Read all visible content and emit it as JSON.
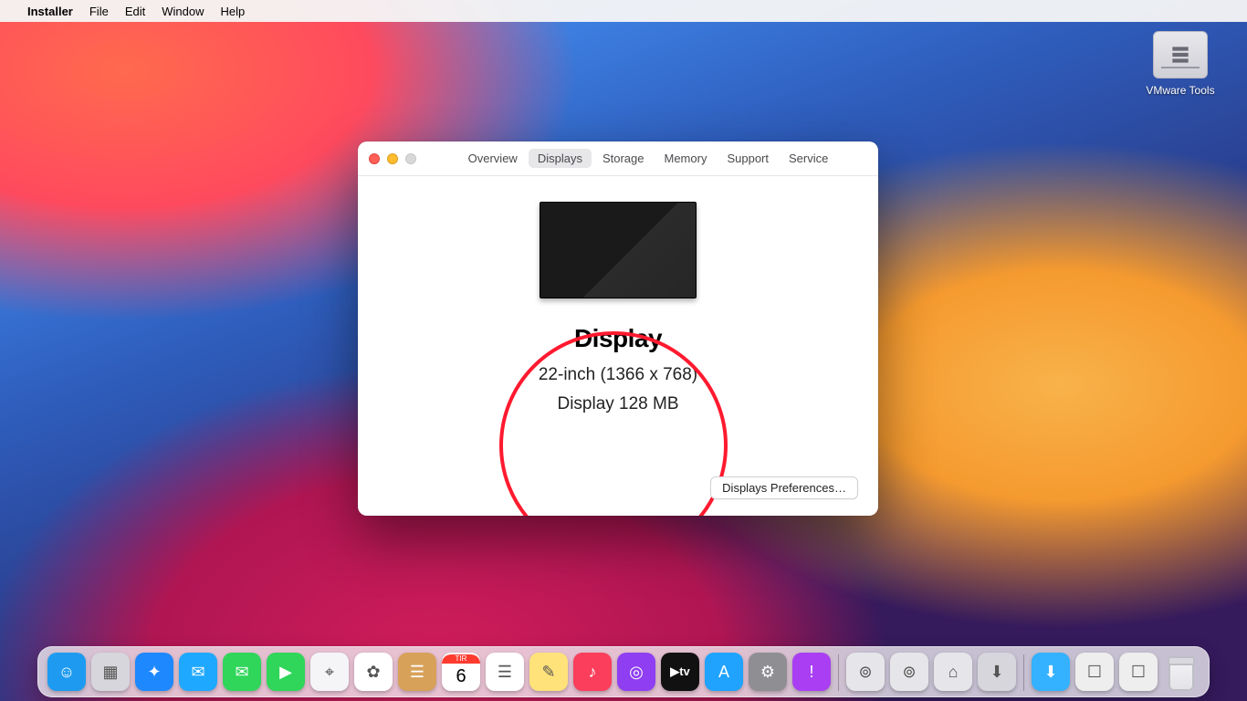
{
  "menubar": {
    "app_name": "Installer",
    "items": [
      "File",
      "Edit",
      "Window",
      "Help"
    ]
  },
  "desktop": {
    "disk_label": "VMware Tools"
  },
  "about_window": {
    "tabs": [
      "Overview",
      "Displays",
      "Storage",
      "Memory",
      "Support",
      "Service"
    ],
    "active_tab_index": 1,
    "display": {
      "title": "Display",
      "size_line": "22-inch (1366 x 768)",
      "gpu_line": "Display 128 MB"
    },
    "prefs_button": "Displays Preferences…"
  },
  "calendar_tile": {
    "weekday": "TIR",
    "day": "6"
  },
  "dock": {
    "main_apps": [
      {
        "name": "finder",
        "color": "#1e9bf0",
        "glyph": "☺"
      },
      {
        "name": "launchpad",
        "color": "#d6d6dc",
        "glyph": "▦"
      },
      {
        "name": "safari",
        "color": "#1e88ff",
        "glyph": "✦"
      },
      {
        "name": "mail",
        "color": "#1fa8ff",
        "glyph": "✉"
      },
      {
        "name": "messages",
        "color": "#2fd65a",
        "glyph": "✉"
      },
      {
        "name": "facetime",
        "color": "#2fd65a",
        "glyph": "▶"
      },
      {
        "name": "maps",
        "color": "#f5f5f8",
        "glyph": "⌖"
      },
      {
        "name": "photos",
        "color": "#ffffff",
        "glyph": "✿"
      },
      {
        "name": "contacts",
        "color": "#d8a15a",
        "glyph": "☰"
      },
      {
        "name": "calendar",
        "color": "#ffffff",
        "glyph": ""
      },
      {
        "name": "reminders",
        "color": "#ffffff",
        "glyph": "☰"
      },
      {
        "name": "notes",
        "color": "#ffe27a",
        "glyph": "✎"
      },
      {
        "name": "music",
        "color": "#fa3e5b",
        "glyph": "♪"
      },
      {
        "name": "podcasts",
        "color": "#8f3ef2",
        "glyph": "◎"
      },
      {
        "name": "tv",
        "color": "#111111",
        "glyph": "tv"
      },
      {
        "name": "app-store",
        "color": "#1fa3ff",
        "glyph": "A"
      },
      {
        "name": "system-prefs",
        "color": "#8e8e93",
        "glyph": "⚙"
      },
      {
        "name": "feedback",
        "color": "#a93ef2",
        "glyph": "!"
      }
    ],
    "util_apps": [
      {
        "name": "macos-installer-1",
        "color": "#e6e6ea",
        "glyph": "⊚"
      },
      {
        "name": "macos-installer-2",
        "color": "#e6e6ea",
        "glyph": "⊚"
      },
      {
        "name": "disk-utility",
        "color": "#e6e6ea",
        "glyph": "⌂"
      },
      {
        "name": "downloads-stack",
        "color": "#d6d6dc",
        "glyph": "⬇"
      }
    ],
    "right_items": [
      {
        "name": "folder-downloads",
        "color": "#34b1ff",
        "glyph": "⬇"
      },
      {
        "name": "doc-preview-1",
        "color": "#eeeeee",
        "glyph": "☐"
      },
      {
        "name": "doc-preview-2",
        "color": "#eeeeee",
        "glyph": "☐"
      }
    ]
  }
}
